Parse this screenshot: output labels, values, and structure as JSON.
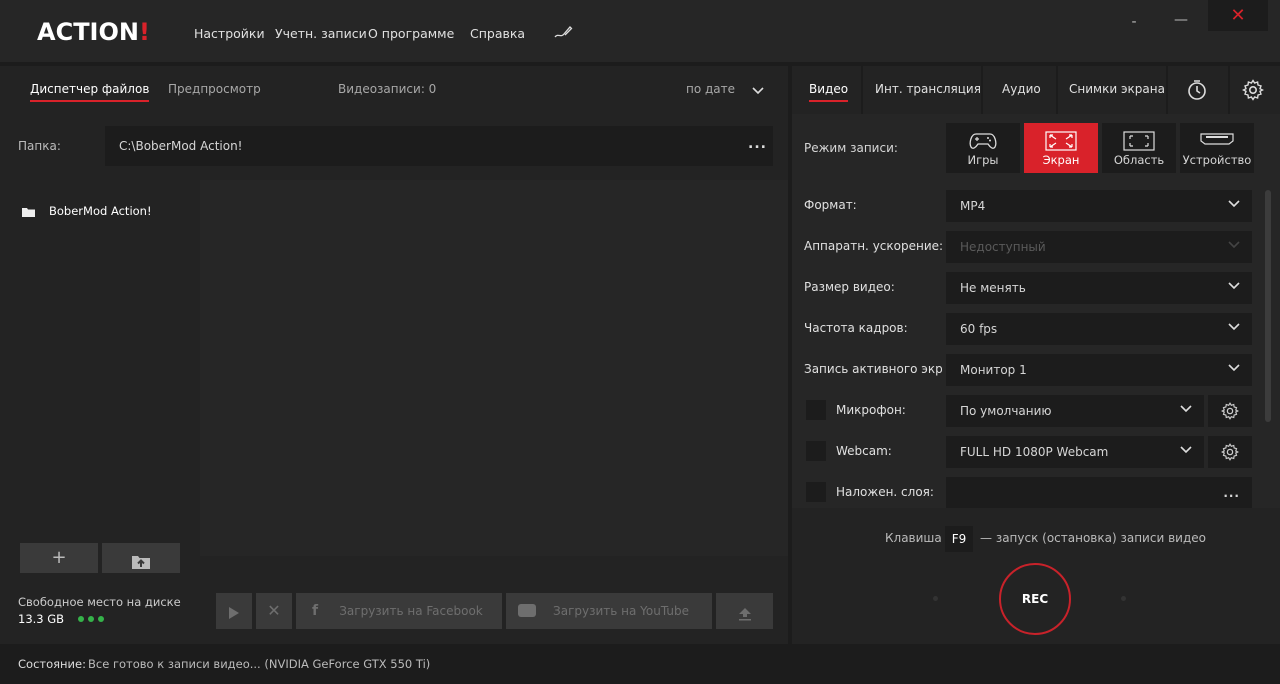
{
  "app": {
    "logo_main": "ACTION",
    "logo_bang": "!"
  },
  "menu": {
    "settings": "Настройки",
    "accounts": "Учетн. записи",
    "about": "О программе",
    "help": "Справка"
  },
  "window": {
    "minimize": "-",
    "maximize": "—",
    "close": "✕"
  },
  "left": {
    "tabs": {
      "file_manager": "Диспетчер файлов",
      "preview": "Предпросмотр",
      "records_count": "Видеозаписи: 0",
      "sort": "по дате"
    },
    "folder": {
      "label": "Папка:",
      "path": "C:\\BoberMod Action!",
      "browse": "..."
    },
    "tree": {
      "root": "BoberMod Action!"
    },
    "disk": {
      "label": "Свободное место на диске",
      "value": "13.3 GB"
    },
    "actions": {
      "facebook": "Загрузить на Facebook",
      "youtube": "Загрузить на YouTube"
    }
  },
  "right": {
    "tabs": {
      "video": "Видео",
      "stream": "Инт. трансляция",
      "audio": "Аудио",
      "screenshots": "Снимки экрана"
    },
    "mode": {
      "label": "Режим записи:",
      "games": "Игры",
      "screen": "Экран",
      "region": "Область",
      "device": "Устройство"
    },
    "settings": {
      "format_label": "Формат:",
      "format_value": "MP4",
      "hw_label": "Аппаратн. ускорение:",
      "hw_value": "Недоступный",
      "size_label": "Размер видео:",
      "size_value": "Не менять",
      "fps_label": "Частота кадров:",
      "fps_value": "60 fps",
      "active_label": "Запись активного экрана:",
      "active_value": "Монитор 1",
      "mic_label": "Микрофон:",
      "mic_value": "По умолчанию",
      "webcam_label": "Webcam:",
      "webcam_value": "FULL HD 1080P Webcam",
      "overlay_label": "Наложен. слоя:",
      "overlay_browse": "..."
    },
    "hotkey": {
      "prefix": "Клавиша",
      "key": "F9",
      "suffix": "— запуск (остановка) записи видео"
    },
    "rec": "REC"
  },
  "status": {
    "label": "Состояние:",
    "text": "Все готово к записи видео... (NVIDIA GeForce GTX 550 Ti)"
  },
  "colors": {
    "accent": "#d9222a",
    "disk_ok": "#35b34a"
  }
}
